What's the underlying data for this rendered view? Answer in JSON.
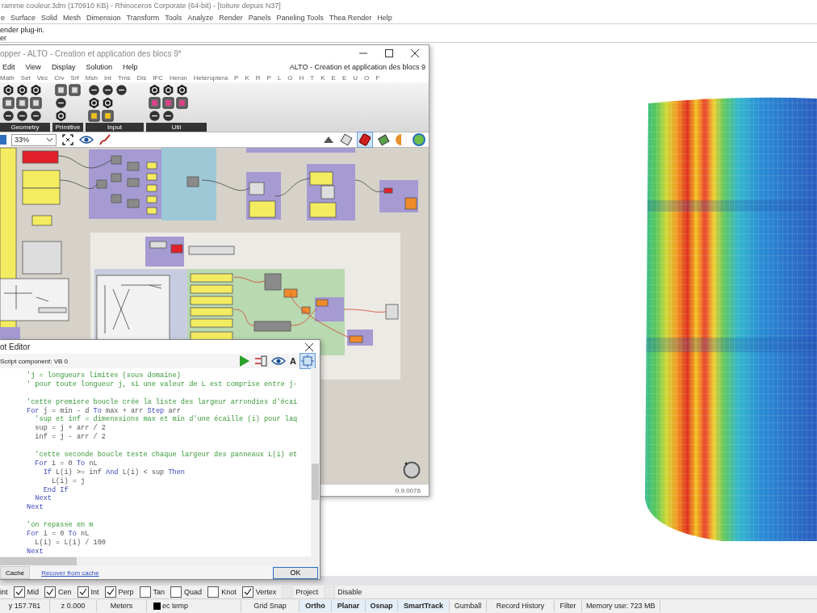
{
  "rhino": {
    "title": "ramme couleur.3dm (170910 KB) - Rhinoceros Corporate (64-bit) - [toiture depuis N37]",
    "menu": [
      "e",
      "Surface",
      "Solid",
      "Mesh",
      "Dimension",
      "Transform",
      "Tools",
      "Analyze",
      "Render",
      "Panels",
      "Paneling Tools",
      "Thea Render",
      "Help"
    ],
    "command_history": [
      "ender plug-in.",
      "er"
    ]
  },
  "grasshopper": {
    "title": "opper - ALTO - Creation et application des blocs 9*",
    "menu": [
      "Edit",
      "View",
      "Display",
      "Solution",
      "Help"
    ],
    "document_title": "ALTO - Creation et application des blocs 9",
    "tabs": [
      "Math",
      "Set",
      "Vec",
      "Crv",
      "Srf",
      "Msh",
      "Int",
      "Trns",
      "Dis",
      "IFC",
      "Heron",
      "Heteroptera",
      "P",
      "K",
      "R",
      "P",
      "L",
      "G",
      "H",
      "T",
      "K",
      "E",
      "E",
      "U",
      "O",
      "F"
    ],
    "ribbon_groups": [
      {
        "label": "Geometry"
      },
      {
        "label": "Primitive"
      },
      {
        "label": "Input"
      },
      {
        "label": "Util"
      }
    ],
    "zoom": "33%",
    "version": "0.9.0076"
  },
  "script_editor": {
    "title": "ot Editor",
    "component": "Script component: VB 0",
    "font_button": "A",
    "code": [
      {
        "gap_before": false,
        "tokens": [
          {
            "kind": "comment",
            "text": "'j = longueurs limites (sous domaine)"
          }
        ]
      },
      {
        "gap_before": false,
        "tokens": [
          {
            "kind": "comment",
            "text": "' pour toute longueur j, si une valeur de L est comprise entre j-"
          }
        ]
      },
      {
        "gap_before": true,
        "tokens": [
          {
            "kind": "comment",
            "text": "'cette premiere boucle crée la liste des largeur arrondies d'écai"
          }
        ]
      },
      {
        "gap_before": false,
        "tokens": [
          {
            "kind": "keyword",
            "text": "For"
          },
          {
            "kind": "plain",
            "text": " j = min - d "
          },
          {
            "kind": "keyword",
            "text": "To"
          },
          {
            "kind": "plain",
            "text": " max + arr "
          },
          {
            "kind": "keyword",
            "text": "Step"
          },
          {
            "kind": "plain",
            "text": " arr"
          }
        ]
      },
      {
        "gap_before": false,
        "tokens": [
          {
            "kind": "comment",
            "text": "  'sup et inf = dimenssions max et min d'une écaille (i) pour laq"
          }
        ]
      },
      {
        "gap_before": false,
        "tokens": [
          {
            "kind": "plain",
            "text": "  sup = j + arr / 2"
          }
        ]
      },
      {
        "gap_before": false,
        "tokens": [
          {
            "kind": "plain",
            "text": "  inf = j - arr / 2"
          }
        ]
      },
      {
        "gap_before": true,
        "tokens": [
          {
            "kind": "comment",
            "text": "  'cette seconde boucle teste chaque largeur des panneaux L(i) et"
          }
        ]
      },
      {
        "gap_before": false,
        "tokens": [
          {
            "kind": "keyword",
            "text": "  For"
          },
          {
            "kind": "plain",
            "text": " i = 0 "
          },
          {
            "kind": "keyword",
            "text": "To"
          },
          {
            "kind": "plain",
            "text": " nL"
          }
        ]
      },
      {
        "gap_before": false,
        "tokens": [
          {
            "kind": "keyword",
            "text": "    If"
          },
          {
            "kind": "plain",
            "text": " L(i) >= inf "
          },
          {
            "kind": "keyword",
            "text": "And"
          },
          {
            "kind": "plain",
            "text": " L(i) < sup "
          },
          {
            "kind": "keyword",
            "text": "Then"
          }
        ]
      },
      {
        "gap_before": false,
        "tokens": [
          {
            "kind": "plain",
            "text": "      L(i) = j"
          }
        ]
      },
      {
        "gap_before": false,
        "tokens": [
          {
            "kind": "keyword",
            "text": "    End If"
          }
        ]
      },
      {
        "gap_before": false,
        "tokens": [
          {
            "kind": "keyword",
            "text": "  Next"
          }
        ]
      },
      {
        "gap_before": false,
        "tokens": [
          {
            "kind": "keyword",
            "text": "Next"
          }
        ]
      },
      {
        "gap_before": true,
        "tokens": [
          {
            "kind": "comment",
            "text": "'on repasse en m"
          }
        ]
      },
      {
        "gap_before": false,
        "tokens": [
          {
            "kind": "keyword",
            "text": "For"
          },
          {
            "kind": "plain",
            "text": " i = 0 "
          },
          {
            "kind": "keyword",
            "text": "To"
          },
          {
            "kind": "plain",
            "text": " nL"
          }
        ]
      },
      {
        "gap_before": false,
        "tokens": [
          {
            "kind": "plain",
            "text": "  L(i) = L(i) / 100"
          }
        ]
      },
      {
        "gap_before": false,
        "tokens": [
          {
            "kind": "keyword",
            "text": "Next"
          }
        ]
      }
    ],
    "cache_button": "Cache",
    "recover_link": "Recover from cache",
    "ok_button": "OK"
  },
  "osnaps": [
    {
      "kind": "label",
      "label": "int"
    },
    {
      "kind": "osnap",
      "label": "Mid",
      "checked": true
    },
    {
      "kind": "osnap",
      "label": "Cen",
      "checked": true
    },
    {
      "kind": "osnap",
      "label": "Int",
      "checked": true
    },
    {
      "kind": "osnap",
      "label": "Perp",
      "checked": true
    },
    {
      "kind": "osnap",
      "label": "Tan",
      "checked": false
    },
    {
      "kind": "osnap",
      "label": "Quad",
      "checked": false
    },
    {
      "kind": "osnap",
      "label": "Knot",
      "checked": false
    },
    {
      "kind": "osnap",
      "label": "Vertex",
      "checked": true
    },
    {
      "kind": "option",
      "label": "Project",
      "checked": false
    },
    {
      "kind": "option",
      "label": "Disable",
      "checked": false
    }
  ],
  "status_bar": [
    {
      "kind": "readout",
      "text": "y 157.781"
    },
    {
      "kind": "readout",
      "text": "z 0.000"
    },
    {
      "kind": "readout",
      "text": "Meters"
    },
    {
      "kind": "layer",
      "text": "ec temp"
    },
    {
      "kind": "pane",
      "text": "Grid Snap",
      "on": false
    },
    {
      "kind": "pane",
      "text": "Ortho",
      "on": true
    },
    {
      "kind": "pane",
      "text": "Planar",
      "on": true
    },
    {
      "kind": "pane",
      "text": "Osnap",
      "on": true
    },
    {
      "kind": "pane",
      "text": "SmartTrack",
      "on": true
    },
    {
      "kind": "pane",
      "text": "Gumball",
      "on": false
    },
    {
      "kind": "pane",
      "text": "Record History",
      "on": false
    },
    {
      "kind": "pane",
      "text": "Filter",
      "on": false
    },
    {
      "kind": "readout",
      "text": "Memory use: 723 MB"
    }
  ]
}
